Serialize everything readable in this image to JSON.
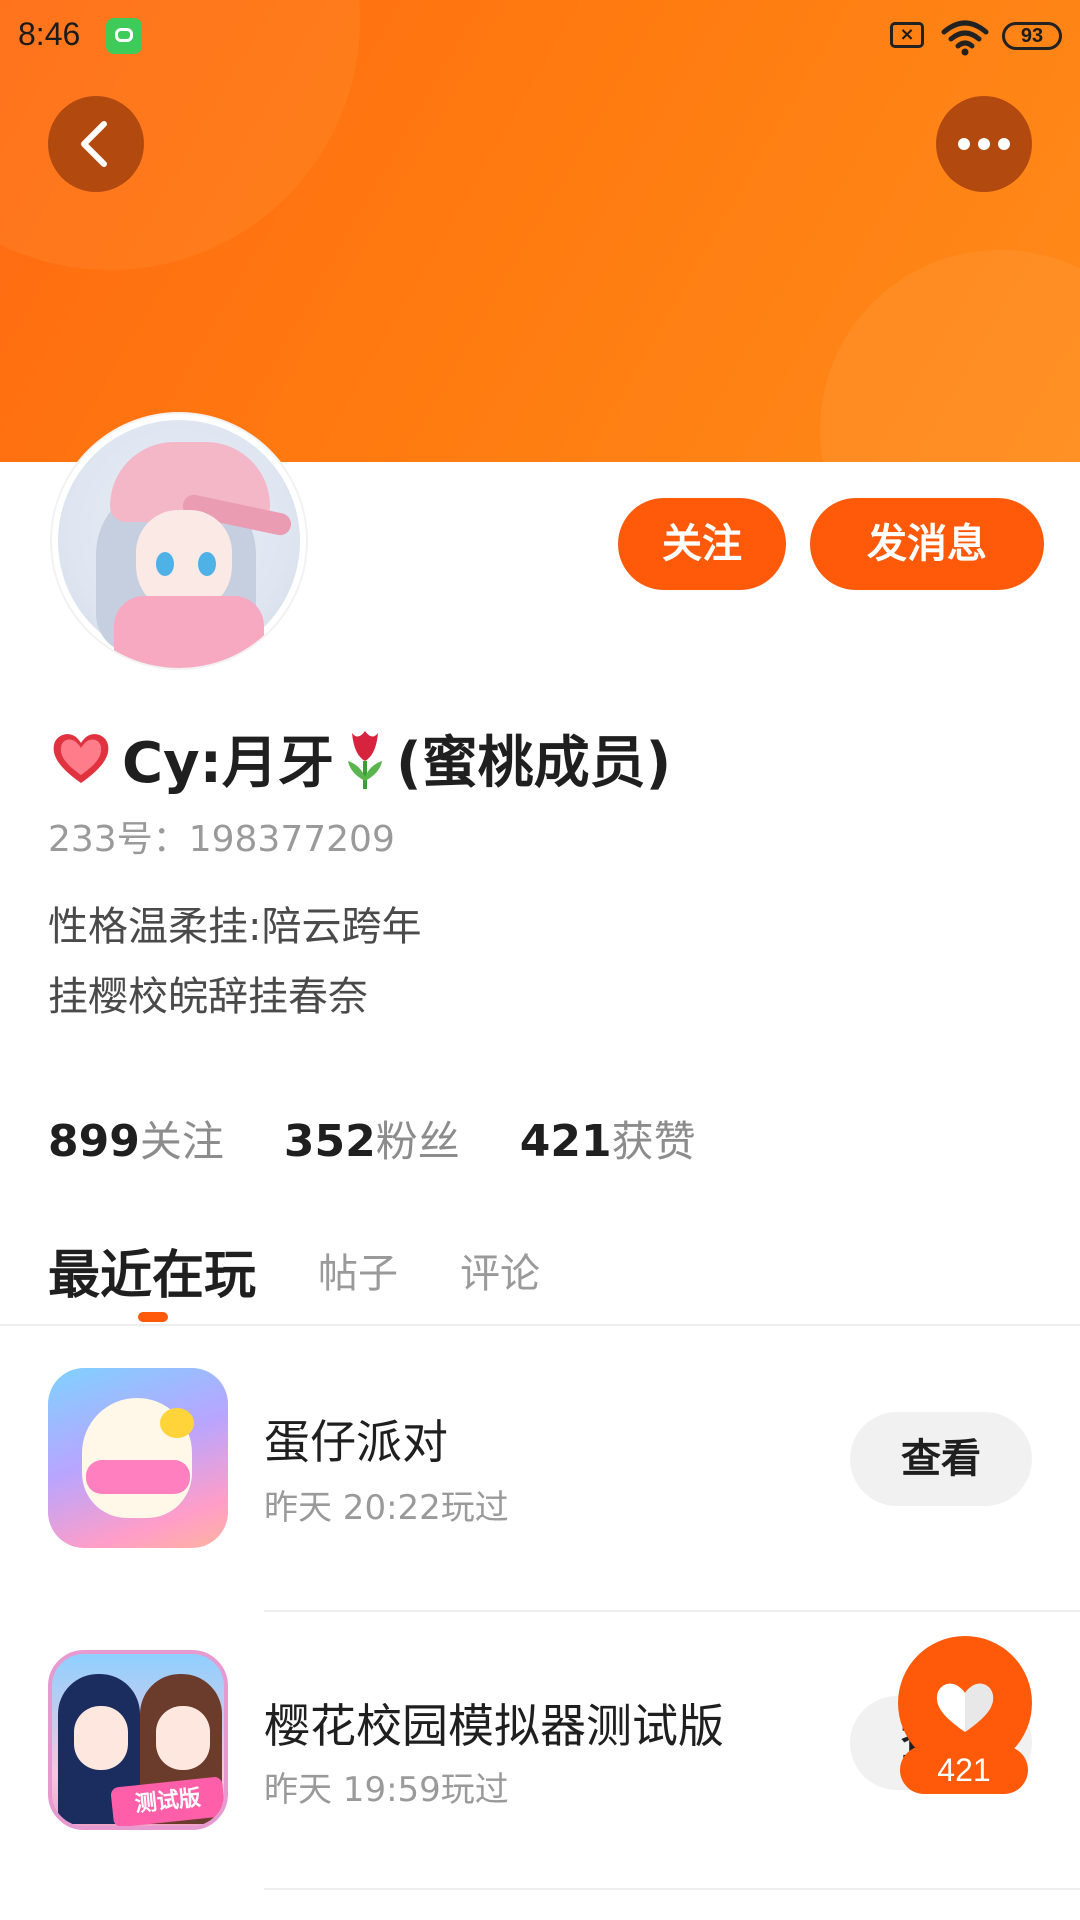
{
  "status_bar": {
    "time": "8:46",
    "battery": "93"
  },
  "profile": {
    "name": "Cy:月牙",
    "name_suffix": "(蜜桃成员)",
    "uid": "233号：198377209",
    "bio": [
      "性格温柔挂:陪云跨年",
      "挂樱校皖辞挂春奈"
    ],
    "follow_label": "关注",
    "message_label": "发消息"
  },
  "stats": [
    {
      "num": "899",
      "label": "关注"
    },
    {
      "num": "352",
      "label": "粉丝"
    },
    {
      "num": "421",
      "label": "获赞"
    }
  ],
  "tabs": [
    {
      "label": "最近在玩",
      "active": true
    },
    {
      "label": "帖子",
      "active": false
    },
    {
      "label": "评论",
      "active": false
    }
  ],
  "games": [
    {
      "title": "蛋仔派对",
      "played": "昨天 20:22玩过",
      "button": "查看",
      "icon": "egg-party-icon"
    },
    {
      "title": "樱花校园模拟器测试版",
      "played": "昨天 19:59玩过",
      "button": "查看",
      "icon": "sakura-school-icon",
      "icon_tag": "测试版"
    }
  ],
  "like_fab": {
    "count": "421",
    "icon": "heart-icon"
  },
  "colors": {
    "accent": "#ff5a0a",
    "banner": "#ff7a10"
  }
}
